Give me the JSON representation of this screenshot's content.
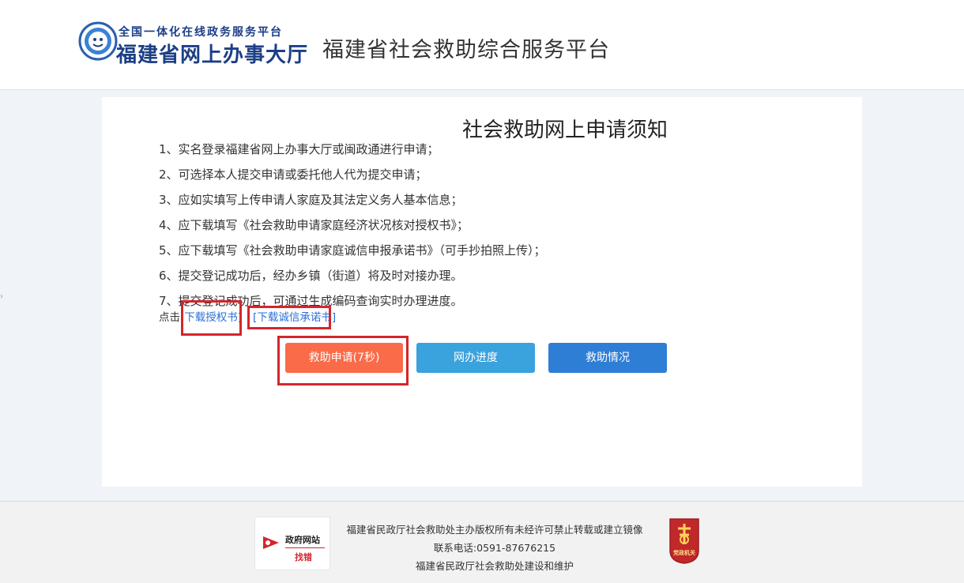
{
  "header": {
    "brand_top": "全国一体化在线政务服务平台",
    "brand_main": "福建省网上办事大厅",
    "platform_name": "福建省社会救助综合服务平台"
  },
  "notice": {
    "title": "社会救助网上申请须知",
    "items": [
      "1、实名登录福建省网上办事大厅或闽政通进行申请；",
      "2、可选择本人提交申请或委托他人代为提交申请；",
      "3、应如实填写上传申请人家庭及其法定义务人基本信息；",
      "4、应下载填写《社会救助申请家庭经济状况核对授权书》；",
      "5、应下载填写《社会救助申请家庭诚信申报承诺书》（可手抄拍照上传）；",
      "6、提交登记成功后，经办乡镇（街道）将及时对接办理。",
      "7、提交登记成功后，可通过生成编码查询实时办理进度。"
    ],
    "download_prefix": "点击",
    "download_auth": "[下载授权书]",
    "download_pledge": "[下载诚信承诺书]"
  },
  "buttons": {
    "apply": "救助申请(7秒)",
    "progress": "网办进度",
    "status": "救助情况"
  },
  "footer": {
    "badge_top": "政府网站",
    "badge_bottom": "找错",
    "copyright": "福建省民政厅社会救助处主办版权所有未经许可禁止转载或建立镜像",
    "phone": "联系电话:0591-87676215",
    "maintainer": "福建省民政厅社会救助处建设和维护",
    "emblem_text": "党政机关"
  },
  "colors": {
    "apply_button": "#fa6b4a",
    "progress_button": "#3aa2dd",
    "status_button": "#2f7ed6",
    "highlight_box": "#d3262c",
    "brand_blue": "#1c3f86",
    "link_blue": "#2a6fd8"
  },
  "icons": {
    "logo": "government-service-logo-icon",
    "badge": "gov-site-error-report-icon",
    "emblem": "party-government-emblem-icon"
  }
}
